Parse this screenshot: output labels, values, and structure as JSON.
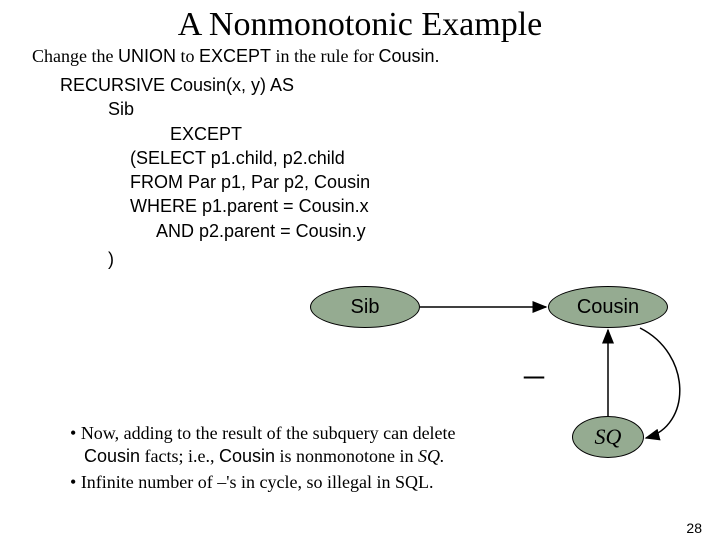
{
  "title": "A Nonmonotonic Example",
  "subtitle_a": "Change the ",
  "subtitle_b": "UNION",
  "subtitle_c": " to ",
  "subtitle_d": "EXCEPT",
  "subtitle_e": " in the rule for ",
  "subtitle_f": "Cousin.",
  "code": {
    "l1": "RECURSIVE Cousin(x, y) AS",
    "l2": "Sib",
    "l3": "EXCEPT",
    "l4a": "(SELECT p1.child, p2.child",
    "l4b": " FROM Par p1, Par p2, Cousin",
    "l4c": " WHERE p1.parent = Cousin.x",
    "l5": "AND p2.parent = Cousin.y",
    "close": ")"
  },
  "nodes": {
    "sib": "Sib",
    "cousin": "Cousin",
    "sq": "SQ"
  },
  "minus": "–",
  "bullets": {
    "b1a": "Now, adding to the result of the subquery can delete ",
    "b1b": "Cousin",
    "b1c": " facts; i.e., ",
    "b1d": "Cousin",
    "b1e": " is nonmonotone in ",
    "b1f": "SQ.",
    "b2": "Infinite number of –'s in cycle, so illegal in SQL."
  },
  "page": "28"
}
